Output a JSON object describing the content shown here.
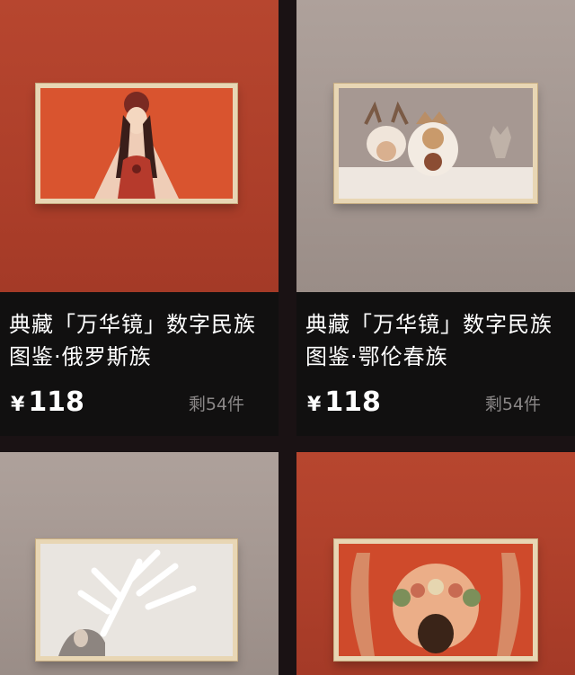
{
  "products": [
    {
      "title": "典藏「万华镜」数字民族图鉴·俄罗斯族",
      "currency": "¥",
      "price": "118",
      "stock": "剩54件",
      "artwork_icon": "veiled-woman-painting-icon",
      "background_color": "#b0432d"
    },
    {
      "title": "典藏「万华镜」数字民族图鉴·鄂伦春族",
      "currency": "¥",
      "price": "118",
      "stock": "剩54件",
      "artwork_icon": "children-in-animal-hats-painting-icon",
      "background_color": "#a89b95"
    },
    {
      "artwork_icon": "white-deer-antlers-painting-icon",
      "background_color": "#a89b95"
    },
    {
      "artwork_icon": "woman-with-flower-headdress-painting-icon",
      "background_color": "#b0432d"
    }
  ]
}
